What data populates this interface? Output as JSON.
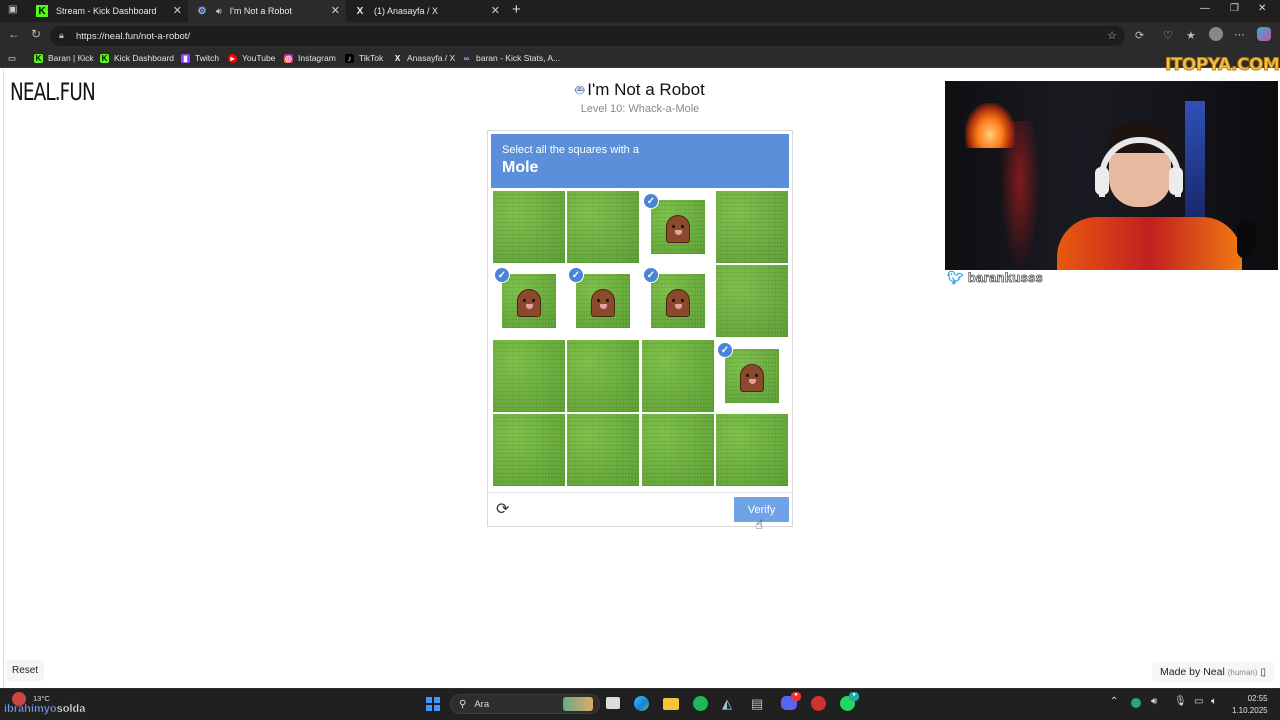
{
  "browser": {
    "tabs": [
      {
        "label": "Stream - Kick Dashboard",
        "icon": "kick-icon",
        "active": false
      },
      {
        "label": "I'm Not a Robot",
        "icon": "robot-icon",
        "active": true
      },
      {
        "label": "(1) Anasayfa / X",
        "icon": "x-icon",
        "active": false
      }
    ],
    "url": "https://neal.fun/not-a-robot/",
    "bookmarks": [
      {
        "label": "Baran | Kick",
        "icon": "kick-icon"
      },
      {
        "label": "Kick Dashboard",
        "icon": "kick-icon"
      },
      {
        "label": "Twitch",
        "icon": "twitch-icon"
      },
      {
        "label": "YouTube",
        "icon": "youtube-icon"
      },
      {
        "label": "Instagram",
        "icon": "instagram-icon"
      },
      {
        "label": "TikTok",
        "icon": "tiktok-icon"
      },
      {
        "label": "Anasayfa / X",
        "icon": "x-icon"
      },
      {
        "label": "baran - Kick Stats, A...",
        "icon": "stats-icon"
      }
    ]
  },
  "page": {
    "logo": "NEAL.FUN",
    "title": "I'm Not a Robot",
    "subtitle": "Level 10: Whack-a-Mole",
    "captcha": {
      "instruction": "Select all the squares with a",
      "target": "Mole",
      "grid": [
        [
          {
            "mole": false,
            "selected": false
          },
          {
            "mole": false,
            "selected": false
          },
          {
            "mole": true,
            "selected": true
          },
          {
            "mole": false,
            "selected": false
          }
        ],
        [
          {
            "mole": true,
            "selected": true
          },
          {
            "mole": true,
            "selected": true
          },
          {
            "mole": true,
            "selected": true
          },
          {
            "mole": false,
            "selected": false
          }
        ],
        [
          {
            "mole": false,
            "selected": false
          },
          {
            "mole": false,
            "selected": false
          },
          {
            "mole": false,
            "selected": false
          },
          {
            "mole": true,
            "selected": true
          }
        ],
        [
          {
            "mole": false,
            "selected": false
          },
          {
            "mole": false,
            "selected": false
          },
          {
            "mole": false,
            "selected": false
          },
          {
            "mole": false,
            "selected": false
          }
        ]
      ],
      "verify_label": "Verify"
    },
    "reset_label": "Reset",
    "made_by": "Made by Neal",
    "made_by_note": "(human)"
  },
  "stream_overlay": {
    "brand": "ITOPYA.COM",
    "handle": "barankusss"
  },
  "taskbar": {
    "weather": "13°C",
    "streamer_name": "ibrahimyo",
    "streamer_suffix": "solda",
    "search_placeholder": "Ara",
    "time": "02:55",
    "date": "1.10.2025"
  },
  "colors": {
    "captcha_header": "#5b8fd9",
    "verify_button": "#6fa3e6",
    "check_badge": "#4a84d6"
  }
}
